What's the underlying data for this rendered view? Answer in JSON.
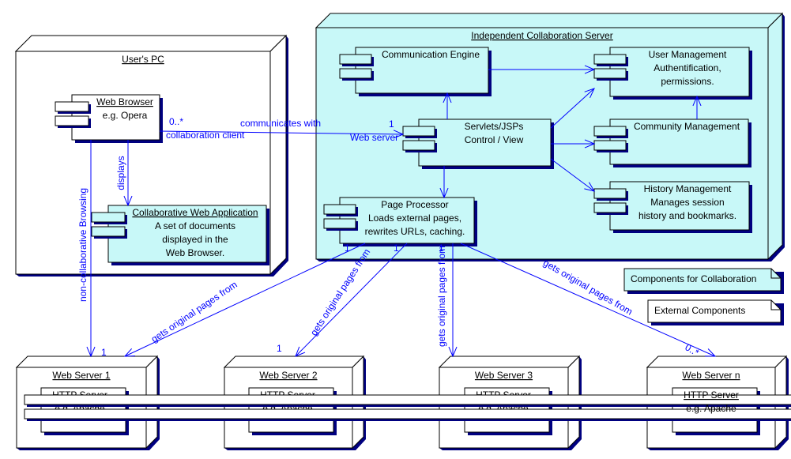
{
  "colors": {
    "component_fill": "#c8f8f8",
    "shadow": "#000080",
    "line": "#0000ff",
    "external_fill": "#ffffff"
  },
  "nodes": {
    "users_pc": {
      "title": "User's PC"
    },
    "server": {
      "title": "Independent Collaboration Server"
    },
    "ws1": {
      "title": "Web Server 1"
    },
    "ws2": {
      "title": "Web Server 2"
    },
    "ws3": {
      "title": "Web Server 3"
    },
    "wsn": {
      "title": "Web Server n"
    }
  },
  "components": {
    "web_browser": {
      "title": "Web Browser",
      "lines": [
        "e.g. Opera"
      ]
    },
    "collab_app": {
      "title": "Collaborative Web Application",
      "lines": [
        "A set of documents",
        "displayed in the",
        "Web Browser."
      ]
    },
    "comm_engine": {
      "title": "Communication Engine",
      "lines": []
    },
    "user_mgmt": {
      "title": "User Management",
      "lines": [
        "Authentification,",
        "permissions."
      ]
    },
    "servlets": {
      "title": "Servlets/JSPs",
      "lines": [
        "Control / View"
      ]
    },
    "community_mgmt": {
      "title": "Community Management",
      "lines": []
    },
    "history_mgmt": {
      "title": "History Management",
      "lines": [
        "Manages session",
        "history and bookmarks."
      ]
    },
    "page_processor": {
      "title": "Page Processor",
      "lines": [
        "Loads external pages,",
        "rewrites URLs, caching."
      ]
    },
    "http1": {
      "title": "HTTP Server",
      "lines": [
        "e.g. Apache"
      ]
    },
    "http2": {
      "title": "HTTP Server",
      "lines": [
        "e.g. Apache"
      ]
    },
    "http3": {
      "title": "HTTP Server",
      "lines": [
        "e.g. Apache"
      ]
    },
    "httpn": {
      "title": "HTTP Server",
      "lines": [
        "e.g. Apache"
      ]
    }
  },
  "notes": {
    "collab_components": "Components for Collaboration",
    "external_components": "External Components"
  },
  "associations": {
    "communicates": {
      "label": "communicates with",
      "client_role": "collaboration client",
      "client_mult": "0..*",
      "server_role": "Web server",
      "server_mult": "1"
    },
    "displays": {
      "label": "displays"
    },
    "non_collab": {
      "label": "non-collaborative Browsing",
      "mult": "1"
    },
    "gets1": {
      "label": "gets original pages from",
      "mult_src": "1",
      "mult_dst": "1"
    },
    "gets2": {
      "label": "gets original pages from",
      "mult_src": "1",
      "mult_dst": "1"
    },
    "gets3": {
      "label": "gets original pages from",
      "mult_src": "1"
    },
    "getsn": {
      "label": "gets original pages from",
      "mult_dst": "0..*"
    }
  }
}
